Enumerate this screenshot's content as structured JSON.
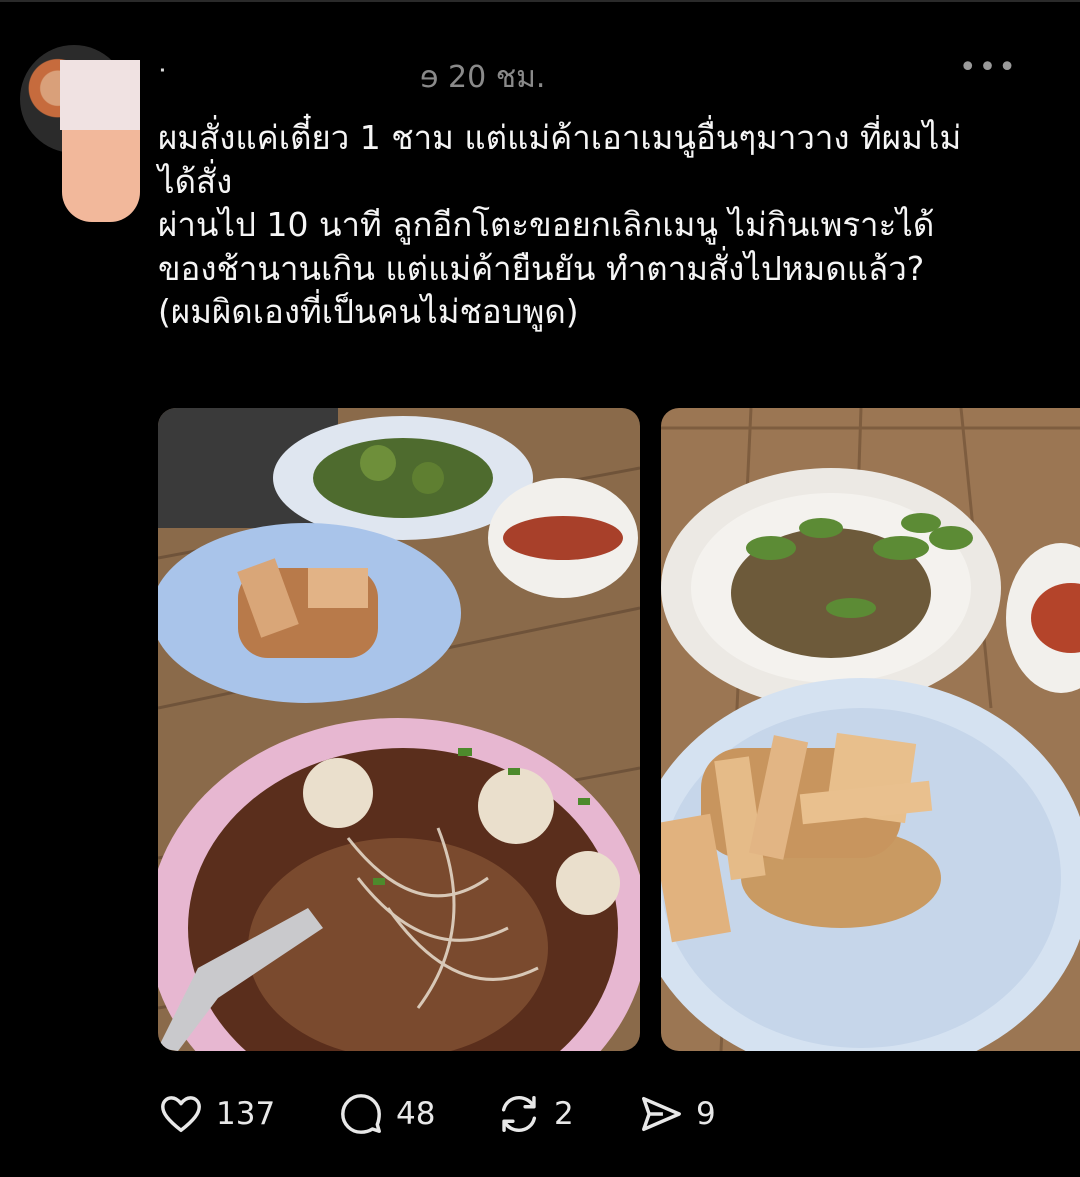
{
  "post": {
    "username": "ᐧ",
    "username_tail": "ɘ",
    "time": "20 ชม.",
    "more_label": "•••",
    "lines": [
      "ผมสั่งแค่เตี๋ยว 1 ชาม แต่แม่ค้าเอาเมนูอื่นๆมาวาง ที่ผมไม่",
      "ได้สั่ง",
      "ผ่านไป 10 นาที ลูกอีกโตะขอยกเลิกเมนู ไม่กินเพราะได้",
      "ของช้านานเกิน แต่แม่ค้ายืนยัน ทำตามสั่งไปหมดแล้ว?",
      "(ผมผิดเองที่เป็นคนไม่ชอบพูด)"
    ]
  },
  "actions": {
    "likes": "137",
    "comments": "48",
    "reposts": "2",
    "shares": "9"
  },
  "icons": {
    "like": "heart-icon",
    "comment": "comment-bubble-icon",
    "repost": "repost-arrows-icon",
    "share": "send-icon",
    "more": "more-dots-icon"
  },
  "colors": {
    "background": "#000000",
    "text": "#f5f5f5",
    "muted": "#8a8a8a"
  }
}
